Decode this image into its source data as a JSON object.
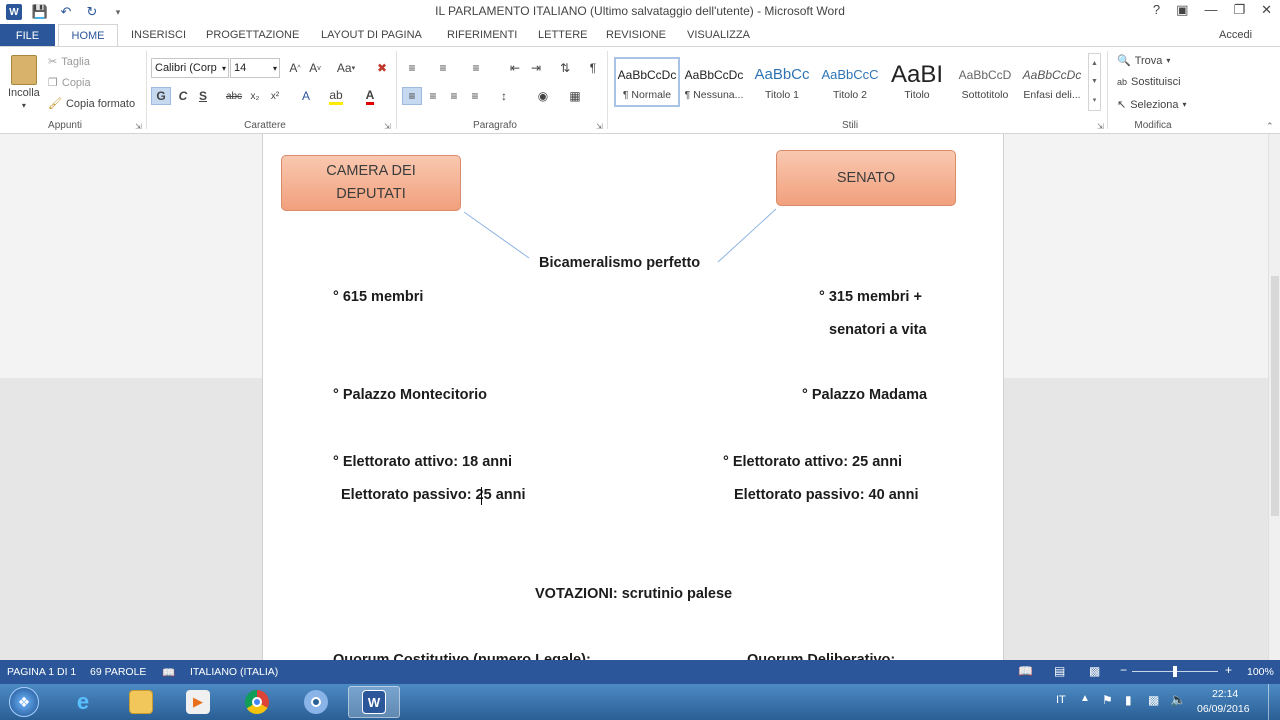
{
  "window": {
    "title": "IL  PARLAMENTO  ITALIANO (Ultimo salvataggio dell'utente) - Microsoft Word"
  },
  "qat": {
    "icons": [
      "word-icon",
      "save-icon",
      "undo-icon",
      "redo-icon",
      "customize-icon"
    ]
  },
  "tabs": {
    "file": "FILE",
    "home": "HOME",
    "inserisci": "INSERISCI",
    "progettazione": "PROGETTAZIONE",
    "layout": "LAYOUT DI PAGINA",
    "riferimenti": "RIFERIMENTI",
    "lettere": "LETTERE",
    "revisione": "REVISIONE",
    "visualizza": "VISUALIZZA",
    "accedi": "Accedi"
  },
  "ribbon": {
    "appunti": {
      "label": "Appunti",
      "incolla": "Incolla",
      "taglia": "Taglia",
      "copia": "Copia",
      "copia_formato": "Copia formato"
    },
    "carattere": {
      "label": "Carattere",
      "font": "Calibri (Corp",
      "size": "14",
      "bold": "G",
      "italic": "C",
      "underline": "S",
      "strike": "abc",
      "sub": "x₂",
      "sup": "x²",
      "case": "Aa"
    },
    "paragrafo": {
      "label": "Paragrafo",
      "pilcrow": "¶"
    },
    "stili": {
      "label": "Stili",
      "items": [
        {
          "preview": "AaBbCcDc",
          "name": "¶ Normale"
        },
        {
          "preview": "AaBbCcDc",
          "name": "¶ Nessuna..."
        },
        {
          "preview": "AaBbCc",
          "name": "Titolo 1"
        },
        {
          "preview": "AaBbCcC",
          "name": "Titolo 2"
        },
        {
          "preview": "AaBI",
          "name": "Titolo"
        },
        {
          "preview": "AaBbCcD",
          "name": "Sottotitolo"
        },
        {
          "preview": "AaBbCcDc",
          "name": "Enfasi deli..."
        }
      ]
    },
    "modifica": {
      "label": "Modifica",
      "trova": "Trova",
      "sostituisci": "Sostituisci",
      "seleziona": "Seleziona"
    }
  },
  "document": {
    "box_camera": "CAMERA DEI DEPUTATI",
    "box_senato": "SENATO",
    "center": "Bicameralismo perfetto",
    "left": {
      "membri": "° 615 membri",
      "palazzo": "° Palazzo Montecitorio",
      "attivo": "° Elettorato attivo: 18 anni",
      "passivo": "Elettorato passivo: 25 anni"
    },
    "right": {
      "membri_1": "° 315 membri +",
      "membri_2": "senatori a vita",
      "palazzo": "° Palazzo Madama",
      "attivo": "° Elettorato attivo: 25 anni",
      "passivo": "Elettorato passivo: 40 anni"
    },
    "votazioni": "VOTAZIONI: scrutinio palese",
    "quorum_left": "Quorum Costitutivo (numero Legale):",
    "quorum_right": "Quorum Deliberativo:"
  },
  "status": {
    "pagina": "PAGINA 1 DI 1",
    "parole": "69 PAROLE",
    "lingua": "ITALIANO (ITALIA)",
    "zoom": "100%"
  },
  "taskbar": {
    "lang": "IT",
    "time": "22:14",
    "date": "06/09/2016"
  },
  "colors": {
    "accent": "#2b579a",
    "box_fill": "#f4b08f"
  }
}
